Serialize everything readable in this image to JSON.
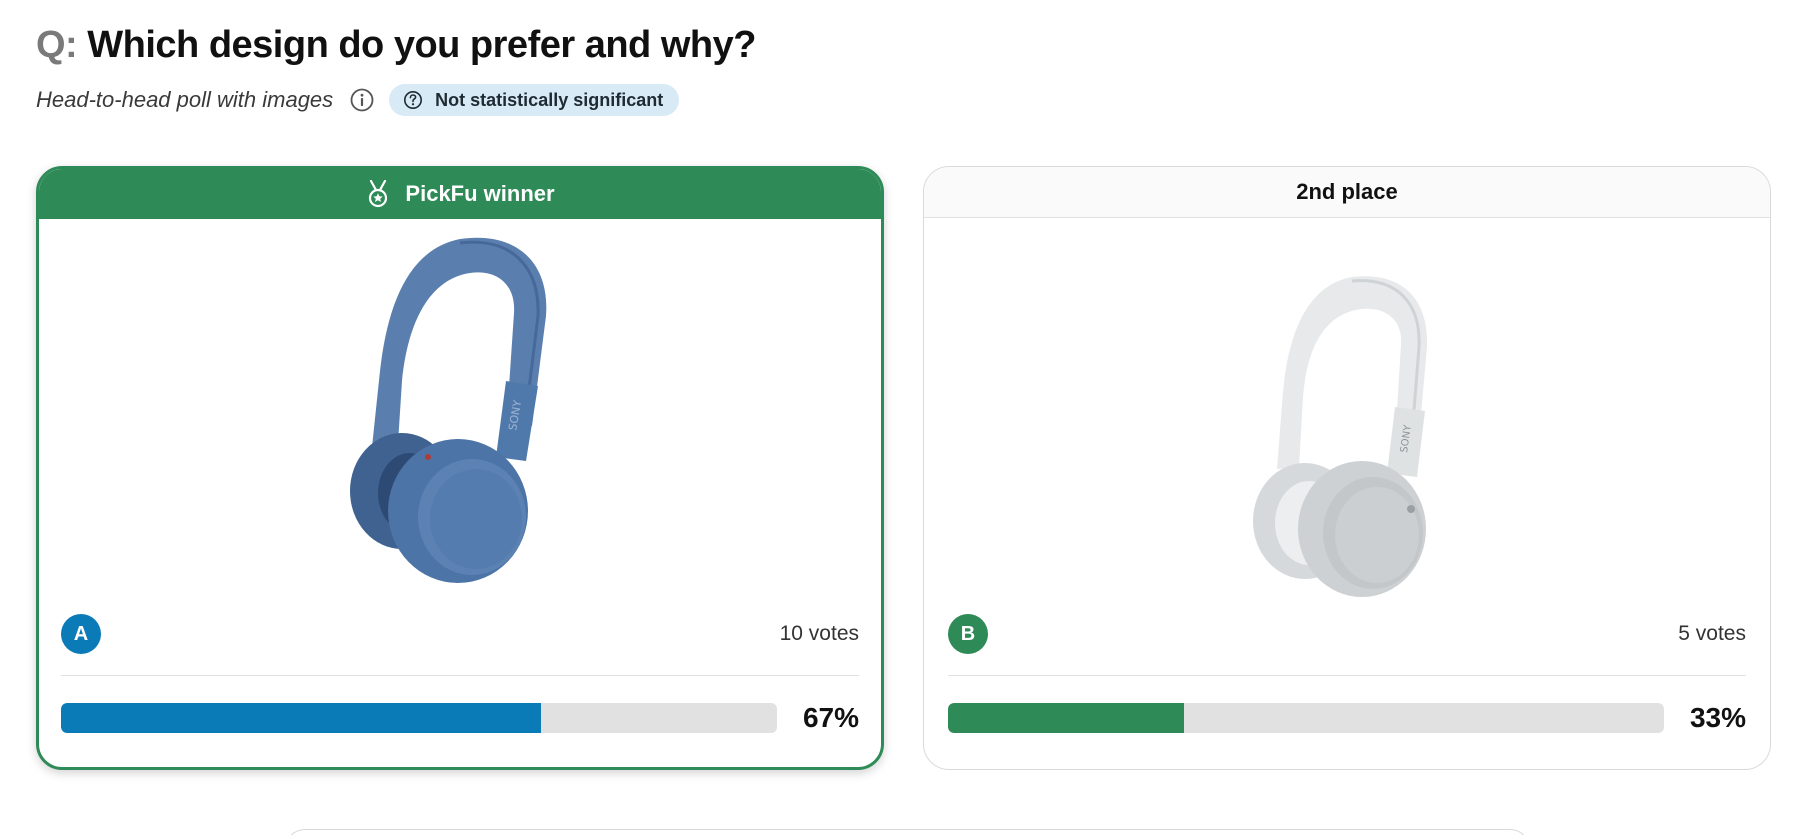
{
  "question": {
    "prefix": "Q:",
    "text": "Which design do you prefer and why?"
  },
  "subtitle": "Head-to-head poll with images",
  "info_icon": "info-circle-icon",
  "significance_badge": {
    "icon": "question-circle-icon",
    "label": "Not statistically significant"
  },
  "colors": {
    "winner_green": "#2e8b57",
    "option_a_blue": "#0b7bb8",
    "badge_bg": "#d7eaf6",
    "bar_track": "#e1e1e1"
  },
  "options": [
    {
      "header_label": "PickFu winner",
      "header_icon": "medal-icon",
      "image": "blue-headphones",
      "letter": "A",
      "votes_label": "10 votes",
      "votes": 10,
      "percent_label": "67%",
      "percent": 67
    },
    {
      "header_label": "2nd place",
      "image": "white-headphones",
      "letter": "B",
      "votes_label": "5 votes",
      "votes": 5,
      "percent_label": "33%",
      "percent": 33
    }
  ]
}
